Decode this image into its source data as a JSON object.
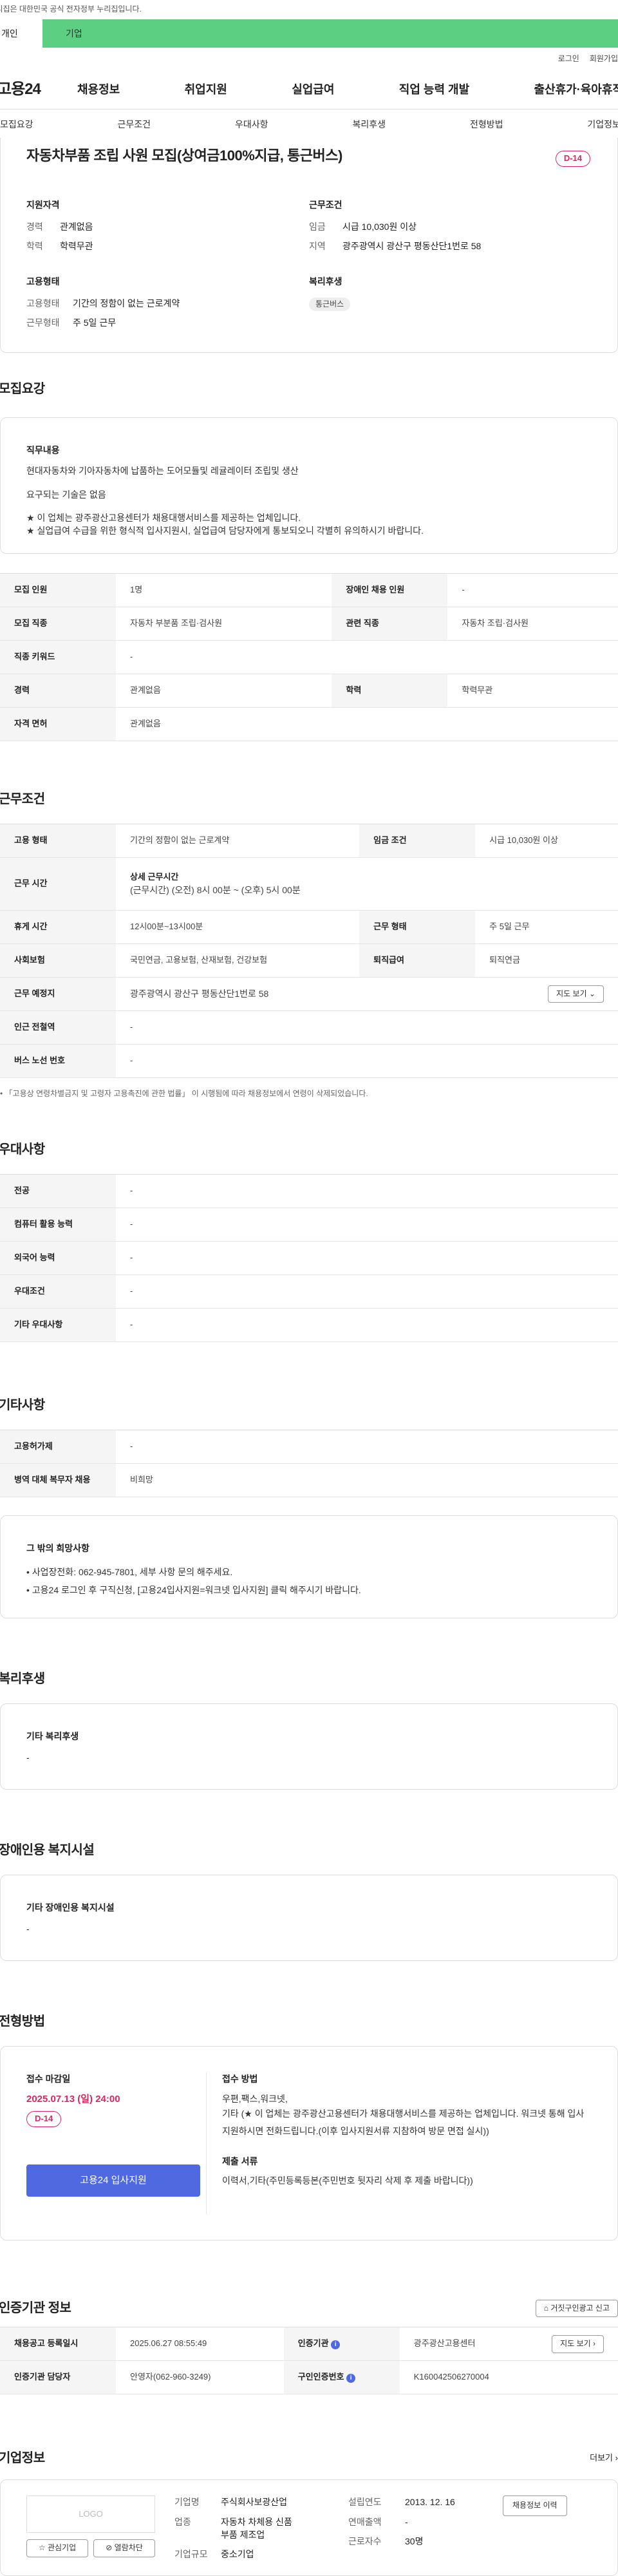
{
  "topnote": "이 누리집은 대한민국 공식 전자정부 누리집입니다.",
  "tabs": {
    "personal": "개인",
    "business": "기업"
  },
  "util": {
    "login": "로그인",
    "signup": "회원가입"
  },
  "logo": "고용24",
  "gnb": [
    "채용정보",
    "취업지원",
    "실업급여",
    "직업 능력 개발",
    "출산휴가·육아휴직"
  ],
  "subtabs": [
    "모집요강",
    "근무조건",
    "우대사항",
    "복리후생",
    "전형방법",
    "기업정보"
  ],
  "hero": {
    "title": "자동차부품 조립 사원 모집(상여금100%지급, 통근버스)",
    "dday": "D-14",
    "qual_title": "지원자격",
    "qual": [
      {
        "k": "경력",
        "v": "관계없음"
      },
      {
        "k": "학력",
        "v": "학력무관"
      }
    ],
    "emp_title": "고용형태",
    "emp": [
      {
        "k": "고용형태",
        "v": "기간의 정함이 없는 근로계약"
      },
      {
        "k": "근무형태",
        "v": "주 5일 근무"
      }
    ],
    "cond_title": "근무조건",
    "cond": [
      {
        "k": "임금",
        "v": "시급 10,030원 이상"
      },
      {
        "k": "지역",
        "v": "광주광역시 광산구 평동산단1번로 58"
      }
    ],
    "welfare_title": "복리후생",
    "welfare_chip": "통근버스"
  },
  "recruit": {
    "title": "모집요강",
    "duty_title": "직무내용",
    "duty_lines": [
      "현대자동차와 기아자동차에 납품하는 도어모듈및 레귤레이터 조립및 생산",
      "요구되는 기술은 없음",
      "★ 이 업체는 광주광산고용센터가 채용대행서비스를 제공하는 업체입니다.",
      "★ 실업급여 수급을 위한 형식적 입사지원시, 실업급여 담당자에게 통보되오니 각별히 유의하시기 바랍니다."
    ],
    "rows": [
      {
        "h1": "모집 인원",
        "v1": "1명",
        "h2": "장애인 채용 인원",
        "v2": "-"
      },
      {
        "h1": "모집 직종",
        "v1": "자동차 부분품 조립·검사원",
        "h2": "관련 직종",
        "v2": "자동차 조립·검사원"
      },
      {
        "h1": "직종 키워드",
        "v1": "-"
      },
      {
        "h1": "경력",
        "v1": "관계없음",
        "h2": "학력",
        "v2": "학력무관"
      },
      {
        "h1": "자격 면허",
        "v1": "관계없음"
      }
    ]
  },
  "workcond": {
    "title": "근무조건",
    "r1": {
      "h1": "고용 형태",
      "v1": "기간의 정함이 없는 근로계약",
      "h2": "임금 조건",
      "v2": "시급 10,030원 이상"
    },
    "r2": {
      "h": "근무 시간",
      "sub": "상세 근무시간",
      "v": "(근무시간) (오전) 8시 00분 ~ (오후) 5시 00분"
    },
    "r3": {
      "h1": "휴게 시간",
      "v1": "12시00분~13시00분",
      "h2": "근무 형태",
      "v2": "주 5일 근무"
    },
    "r4": {
      "h1": "사회보험",
      "v1": "국민연금, 고용보험, 산재보험, 건강보험",
      "h2": "퇴직급여",
      "v2": "퇴직연금"
    },
    "r5": {
      "h": "근무 예정지",
      "v": "광주광역시 광산구 평동산단1번로 58",
      "btn": "지도 보기"
    },
    "r6": {
      "h": "인근 전철역",
      "v": "-"
    },
    "r7": {
      "h": "버스 노선 번호",
      "v": "-"
    },
    "note": "「고용상 연령차별금지 및 고령자 고용촉진에 관한 법률」 이 시행됨에 따라 채용정보에서 연령이 삭제되었습니다."
  },
  "pref": {
    "title": "우대사항",
    "rows": [
      {
        "h": "전공",
        "v": "-"
      },
      {
        "h": "컴퓨터 활용 능력",
        "v": "-"
      },
      {
        "h": "외국어 능력",
        "v": "-"
      },
      {
        "h": "우대조건",
        "v": "-"
      },
      {
        "h": "기타 우대사항",
        "v": "-"
      }
    ]
  },
  "etc": {
    "title": "기타사항",
    "rows": [
      {
        "h": "고용허가제",
        "v": "-"
      },
      {
        "h": "병역 대체 복무자 채용",
        "v": "비희망"
      }
    ],
    "box_title": "그 밖의 희망사항",
    "box_lines": [
      "• 사업장전화: 062-945-7801, 세부 사항 문의 해주세요.",
      "• 고용24 로그인 후 구직신청, [고용24입사지원=워크넷 입사지원] 클릭 해주시기 바랍니다."
    ]
  },
  "welfare": {
    "title": "복리후생",
    "sub": "기타 복리후생",
    "v": "-"
  },
  "disab": {
    "title": "장애인용 복지시설",
    "sub": "기타 장애인용 복지시설",
    "v": "-"
  },
  "select": {
    "title": "전형방법",
    "deadline_label": "접수 마감일",
    "deadline": "2025.07.13 (일) 24:00",
    "dday": "D-14",
    "apply_btn": "고용24 입사지원",
    "method_label": "접수 방법",
    "method_lines": [
      "우편,팩스,워크넷,",
      "기타 (★ 이 업체는 광주광산고용센터가 채용대행서비스를 제공하는 업체입니다. 워크넷 통해 입사지원하시면 전화드립니다.(이후 입사지원서류 지참하여 방문 면접 실시))"
    ],
    "docs_label": "제출 서류",
    "docs": "이력서,기타(주민등록등본(주민번호 뒷자리 삭제 후 제출 바랍니다))"
  },
  "cert": {
    "title": "인증기관 정보",
    "report_btn": "거짓구인광고 신고",
    "r1": {
      "h1": "채용공고 등록일시",
      "v1": "2025.06.27 08:55:49",
      "h2": "인증기관",
      "v2": "광주광산고용센터",
      "btn": "지도 보기"
    },
    "r2": {
      "h1": "인증기관 담당자",
      "v1": "안영자(062-960-3249)",
      "h2": "구인인증번호",
      "v2": "K160042506270004"
    }
  },
  "company": {
    "title": "기업정보",
    "more": "더보기",
    "logo": "LOGO",
    "fav_btn": "관심기업",
    "block_btn": "열람차단",
    "rows": [
      {
        "k": "기업명",
        "v": "주식회사보광산업"
      },
      {
        "k": "업종",
        "v": "자동차 차체용 신품 부품 제조업"
      },
      {
        "k": "기업규모",
        "v": "중소기업"
      }
    ],
    "rows2": [
      {
        "k": "설립연도",
        "v": "2013. 12. 16"
      },
      {
        "k": "연매출액",
        "v": "-"
      },
      {
        "k": "근로자수",
        "v": "30명"
      }
    ],
    "history_btn": "채용정보 이력"
  }
}
